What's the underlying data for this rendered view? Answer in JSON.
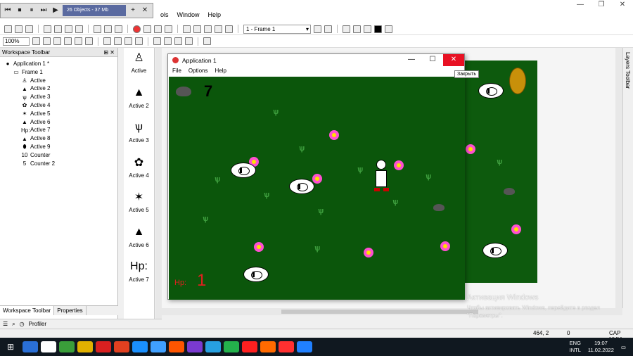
{
  "main_window": {
    "menu": [
      "ols",
      "Window",
      "Help"
    ],
    "controls": [
      "—",
      "❐",
      "✕"
    ]
  },
  "recorder": {
    "info": "26 Objects - 37 Mb",
    "buttons": [
      "⏮",
      "⏹",
      "⏸",
      "⏭",
      "▶"
    ],
    "extra_buttons": [
      "+",
      "✕"
    ]
  },
  "toolbar": {
    "frame_select": "1 - Frame 1",
    "zoom": "100%"
  },
  "workspace": {
    "title": "Workspace Toolbar",
    "pin": "⊞ ✕",
    "tree": [
      {
        "label": "Application 1 *",
        "icon": "●",
        "indent": 0
      },
      {
        "label": "Frame 1",
        "icon": "▭",
        "indent": 1
      },
      {
        "label": "Active",
        "icon": "♙",
        "indent": 2
      },
      {
        "label": "Active 2",
        "icon": "▲",
        "indent": 2
      },
      {
        "label": "Active 3",
        "icon": "ѱ",
        "indent": 2
      },
      {
        "label": "Active 4",
        "icon": "✿",
        "indent": 2
      },
      {
        "label": "Active 5",
        "icon": "✶",
        "indent": 2
      },
      {
        "label": "Active 6",
        "icon": "▲",
        "indent": 2
      },
      {
        "label": "Active 7",
        "icon": "Hp:",
        "indent": 2
      },
      {
        "label": "Active 8",
        "icon": "▲",
        "indent": 2
      },
      {
        "label": "Active 9",
        "icon": "⬮",
        "indent": 2
      },
      {
        "label": "Counter",
        "icon": "10",
        "indent": 2
      },
      {
        "label": "Counter 2",
        "icon": "5",
        "indent": 2
      }
    ],
    "tabs": [
      "Workspace Toolbar",
      "Properties"
    ],
    "profiler": "Profiler"
  },
  "palette": [
    {
      "label": "Active",
      "icon": "♙"
    },
    {
      "label": "Active 2",
      "icon": "▲"
    },
    {
      "label": "Active 3",
      "icon": "ѱ"
    },
    {
      "label": "Active 4",
      "icon": "✿"
    },
    {
      "label": "Active 5",
      "icon": "✶"
    },
    {
      "label": "Active 6",
      "icon": "▲"
    },
    {
      "label": "Active 7",
      "icon": "Hp:"
    }
  ],
  "app_window": {
    "title": "Application 1",
    "menu": [
      "File",
      "Options",
      "Help"
    ],
    "controls": [
      "—",
      "☐",
      "✕"
    ],
    "close_tooltip": "Закрыть"
  },
  "game": {
    "score": "7",
    "hp_label": "Hp:",
    "hp_value": "1"
  },
  "layers_toolbar": "Layers Toolbar",
  "watermark": {
    "title": "Активация Windows",
    "subtitle": "Чтобы активировать Windows, перейдите в раздел \"Параметры\"."
  },
  "status": {
    "coords": "464, 2",
    "objects": "0",
    "caps": "CAP NUM"
  },
  "taskbar": {
    "lang": "ENG",
    "lang2": "INTL",
    "time": "19:07",
    "date": "11.02.2022",
    "colors": [
      "#2a6fd6",
      "#ffffff",
      "#3a9e3a",
      "#e0b000",
      "#d82020",
      "#e04020",
      "#1a90ff",
      "#40a0ff",
      "#ff5500",
      "#7a3ad0",
      "#27a0e0",
      "#24b24c",
      "#ff2020",
      "#ff6a00",
      "#ff3030",
      "#2080ff"
    ]
  }
}
